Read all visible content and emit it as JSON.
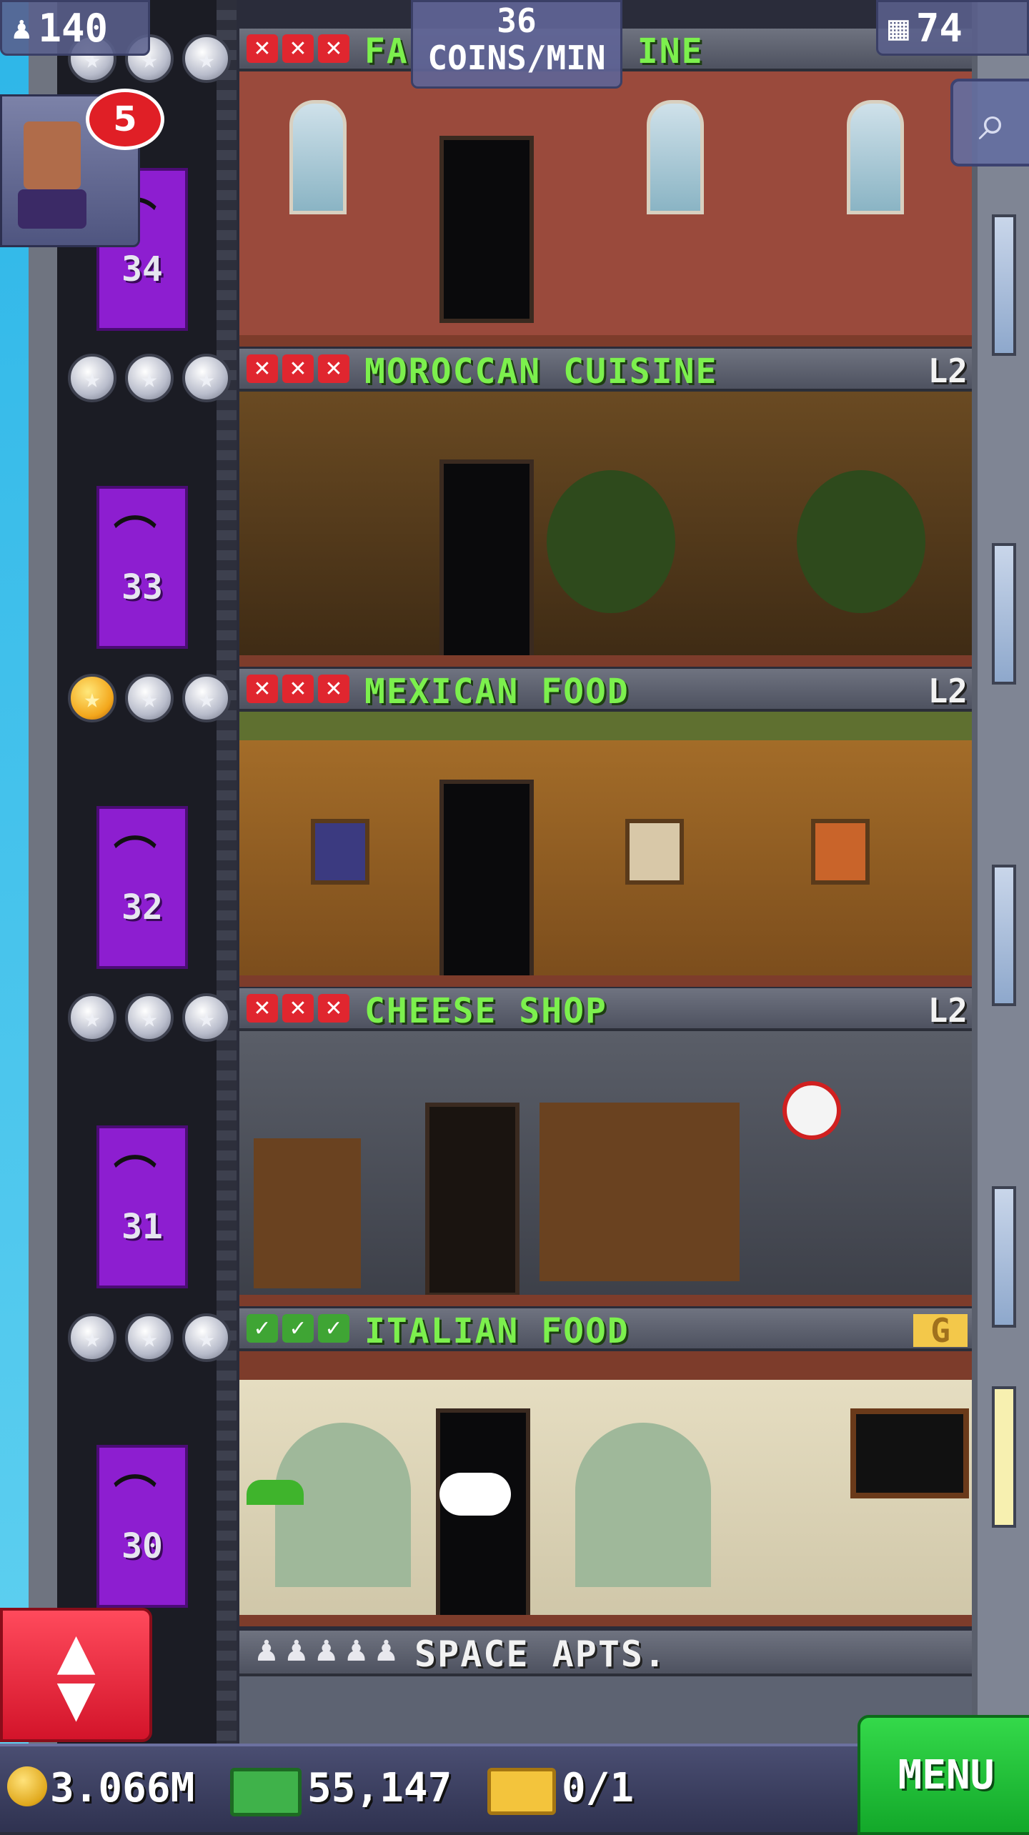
{
  "hud": {
    "population": "140",
    "coins_per_min_value": "36",
    "coins_per_min_label": "COINS/MIN",
    "floor_count": "74",
    "notification_count": "5"
  },
  "floors": [
    {
      "name": "FA",
      "name_tail": "INE",
      "level": "",
      "number": "34",
      "checks": [
        "x",
        "x",
        "x"
      ],
      "stars_gold": 0
    },
    {
      "name": "MOROCCAN CUISINE",
      "level": "L2",
      "number": "33",
      "checks": [
        "x",
        "x",
        "x"
      ],
      "stars_gold": 0
    },
    {
      "name": "MEXICAN FOOD",
      "level": "L2",
      "number": "32",
      "checks": [
        "x",
        "x",
        "x"
      ],
      "stars_gold": 1
    },
    {
      "name": "CHEESE SHOP",
      "level": "L2",
      "number": "31",
      "checks": [
        "x",
        "x",
        "x"
      ],
      "stars_gold": 0
    },
    {
      "name": "ITALIAN FOOD",
      "level": "G",
      "number": "30",
      "checks": [
        "ok",
        "ok",
        "ok"
      ],
      "stars_gold": 0
    }
  ],
  "space_floor": {
    "name": "SPACE APTS."
  },
  "bottom": {
    "coins": "3.066M",
    "bux": "55,147",
    "tickets": "0/1",
    "menu_label": "MENU"
  },
  "colors": {
    "floor_name": "#7cf04d",
    "elevator": "#8d1ed0",
    "menu": "#22c23a",
    "elevator_button": "#e8243a"
  }
}
